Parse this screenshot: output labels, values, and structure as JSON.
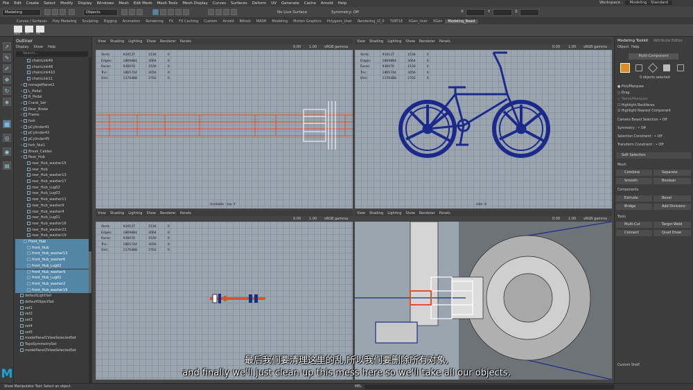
{
  "menu": [
    "File",
    "Edit",
    "Create",
    "Select",
    "Modify",
    "Display",
    "Windows",
    "Mesh",
    "Edit Mesh",
    "Mesh Tools",
    "Mesh Display",
    "Curves",
    "Surfaces",
    "Deform",
    "UV",
    "Generate",
    "Cache",
    "Arnold",
    "Help"
  ],
  "workspace": {
    "label": "Workspace :",
    "value": "Modeling - Standard"
  },
  "toolbar": {
    "mode": "Modeling",
    "objects": "Objects",
    "live": "No Live Surface",
    "symmetry": "Symmetry: Off",
    "xyz": [
      "X",
      "Y",
      "Z"
    ]
  },
  "shelf_tabs": [
    "Curves / Surfaces",
    "Poly Modeling",
    "Sculpting",
    "Rigging",
    "Animation",
    "Rendering",
    "FX",
    "FX Caching",
    "Custom",
    "Arnold",
    "Bifrost",
    "MASH",
    "Modeling",
    "Motion Graphics",
    "Polygons_User",
    "Rendering_IZ_0",
    "TURTLE",
    "XGen_User",
    "XGen",
    "Modeling_Beast"
  ],
  "shelf_items": [
    "Vert",
    "PT",
    "PC"
  ],
  "outliner": {
    "title": "Outliner",
    "menu": [
      "Display",
      "Show",
      "Help"
    ],
    "search": "Search...",
    "rows": [
      {
        "t": "chainLink49",
        "sel": false,
        "i": 2
      },
      {
        "t": "chainLink48",
        "sel": false,
        "i": 2
      },
      {
        "t": "chainLink410",
        "sel": false,
        "i": 2
      },
      {
        "t": "chainLink11",
        "sel": false,
        "i": 2
      },
      {
        "t": "nonagePlanet2",
        "sel": false,
        "i": 1
      },
      {
        "t": "L_Pedal",
        "sel": false,
        "i": 1
      },
      {
        "t": "R_Pedal",
        "sel": false,
        "i": 1
      },
      {
        "t": "Crank_Set",
        "sel": false,
        "i": 1
      },
      {
        "t": "Rear_Brake",
        "sel": false,
        "i": 1
      },
      {
        "t": "Frame",
        "sel": false,
        "i": 1
      },
      {
        "t": "fork",
        "sel": false,
        "i": 1
      },
      {
        "t": "pCylinder41",
        "sel": false,
        "i": 1
      },
      {
        "t": "pCylinder43",
        "sel": false,
        "i": 1
      },
      {
        "t": "pCylinder45",
        "sel": false,
        "i": 1
      },
      {
        "t": "fork_Nut1",
        "sel": false,
        "i": 1
      },
      {
        "t": "Break_Cables",
        "sel": false,
        "i": 1
      },
      {
        "t": "Rear_Hub",
        "sel": false,
        "i": 1
      },
      {
        "t": "rear_Hub_washer15",
        "sel": false,
        "i": 2
      },
      {
        "t": "rear_Hub",
        "sel": false,
        "i": 2
      },
      {
        "t": "rear_Hub_washer13",
        "sel": false,
        "i": 2
      },
      {
        "t": "rear_Hub_washer17",
        "sel": false,
        "i": 2
      },
      {
        "t": "rear_Hub_Lug02",
        "sel": false,
        "i": 2
      },
      {
        "t": "rear_Hub_Lug03",
        "sel": false,
        "i": 2
      },
      {
        "t": "rear_Hub_washer11",
        "sel": false,
        "i": 2
      },
      {
        "t": "rear_Hub_washer9",
        "sel": false,
        "i": 2
      },
      {
        "t": "rear_Hub_washer4",
        "sel": false,
        "i": 2
      },
      {
        "t": "rear_Hub_Lug01",
        "sel": false,
        "i": 2
      },
      {
        "t": "rear_Hub_washer16",
        "sel": false,
        "i": 2
      },
      {
        "t": "rear_Hub_washer21",
        "sel": false,
        "i": 2
      },
      {
        "t": "rear_Hub_washer19",
        "sel": false,
        "i": 2
      },
      {
        "t": "Front_Hub",
        "sel": true,
        "i": 1
      },
      {
        "t": "front_Hub",
        "sel": true,
        "i": 2
      },
      {
        "t": "front_Hub_washer13",
        "sel": true,
        "i": 2
      },
      {
        "t": "front_Hub_washer6",
        "sel": true,
        "i": 2
      },
      {
        "t": "front_Hub_Lug02",
        "sel": true,
        "i": 2
      },
      {
        "t": "front_Hub_washer9",
        "sel": true,
        "i": 2
      },
      {
        "t": "front_Hub_Lug01",
        "sel": true,
        "i": 2
      },
      {
        "t": "front_Hub_washer2",
        "sel": true,
        "i": 2
      },
      {
        "t": "front_Hub_washer19",
        "sel": true,
        "i": 2
      },
      {
        "t": "defaultLightSet",
        "sel": false,
        "i": 0
      },
      {
        "t": "defaultObjectSet",
        "sel": false,
        "i": 0
      },
      {
        "t": "set1",
        "sel": false,
        "i": 0
      },
      {
        "t": "set2",
        "sel": false,
        "i": 0
      },
      {
        "t": "set3",
        "sel": false,
        "i": 0
      },
      {
        "t": "set4",
        "sel": false,
        "i": 0
      },
      {
        "t": "set5",
        "sel": false,
        "i": 0
      },
      {
        "t": "modelPanel1ViewSelectedSet",
        "sel": false,
        "i": 0
      },
      {
        "t": "TopoSymmetrySet",
        "sel": false,
        "i": 0
      },
      {
        "t": "modelPanel3ViewSelectedSet",
        "sel": false,
        "i": 0
      }
    ]
  },
  "viewport_menu": [
    "View",
    "Shading",
    "Lighting",
    "Show",
    "Renderer",
    "Panels"
  ],
  "hud": {
    "labels": [
      "Verts:",
      "Edges:",
      "Faces:",
      "Tris:",
      "UVs:"
    ],
    "v1": [
      "934127",
      "1869884",
      "936070",
      "1865744",
      "1176488"
    ],
    "v2": [
      "1536",
      "3064",
      "1530",
      "3056",
      "2702"
    ],
    "v3": [
      "0",
      "0",
      "0",
      "0",
      "0"
    ]
  },
  "vp_labels": {
    "top": "Unstable : top  -Y",
    "side": "side  -X"
  },
  "vp_values": {
    "zero": "0.00",
    "one": "1.00",
    "gamma": "sRGB gamma"
  },
  "right_panel": {
    "tabs": [
      "Modeling Toolkit",
      "Attribute Editor"
    ],
    "menu": [
      "Object",
      "Help"
    ],
    "multi": "Multi-Component",
    "selected": "0 objects selected",
    "opts": [
      "Pick/Marquee",
      "Drag",
      "Tweak/Marquee",
      "Highlight Backfaces",
      "Highlight Nearest Component"
    ],
    "camera": "Camera Based Selection",
    "symmetry": "Symmetry :",
    "sym_c": "Selection Constraint :",
    "transform": "Transform Constraint :",
    "off": "Off",
    "soft": "Soft Selection",
    "mesh": "Mesh",
    "combine": "Combine",
    "separate": "Separate",
    "smooth": "Smooth",
    "boolean": "Boolean",
    "components": "Components",
    "extrude": "Extrude",
    "bevel": "Bevel",
    "bridge": "Bridge",
    "add_div": "Add Divisions",
    "tools": "Tools",
    "multicut": "Multi-Cut",
    "target_weld": "Target Weld",
    "connect": "Connect",
    "quad_draw": "Quad Draw",
    "custom": "Custom Shelf"
  },
  "status": {
    "msg": "Show Manipulator Tool: Select an object.",
    "mel": "MEL"
  },
  "subtitle": {
    "zh": "最后我们要清理这里的乱,所以我们要删除所有对象,",
    "en": "and finally we'll just clean up this mess here so we'll take all our objects,"
  },
  "colors": {
    "bike": "#1b2a8a",
    "select": "#5285a6",
    "wire": "#e0502a",
    "grid": "#9aa5b0"
  }
}
